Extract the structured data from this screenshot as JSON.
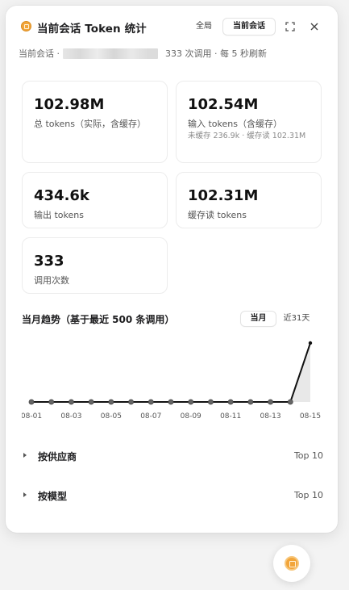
{
  "header": {
    "title": "当前会话 Token 统计",
    "scope_all": "全局",
    "scope_session": "当前会话"
  },
  "subtitle": {
    "prefix": "当前会话 ·",
    "info": "333 次调用 · 每 5 秒刷新"
  },
  "cards": [
    {
      "value": "102.98M",
      "label": "总 tokens（实际，含缓存）"
    },
    {
      "value": "102.54M",
      "label": "输入 tokens（含缓存）",
      "sub": "未缓存 236.9k · 缓存读 102.31M"
    },
    {
      "value": "434.6k",
      "label": "输出 tokens"
    },
    {
      "value": "102.31M",
      "label": "缓存读 tokens"
    },
    {
      "value": "333",
      "label": "调用次数"
    }
  ],
  "trend": {
    "title": "当月趋势（基于最近 500 条调用）",
    "toggle_month": "当月",
    "toggle_31": "近31天"
  },
  "chart_data": {
    "type": "line",
    "x": [
      "08-01",
      "08-02",
      "08-03",
      "08-04",
      "08-05",
      "08-06",
      "08-07",
      "08-08",
      "08-09",
      "08-10",
      "08-11",
      "08-12",
      "08-13",
      "08-14",
      "08-15"
    ],
    "tick_labels": [
      "08-01",
      "08-03",
      "08-05",
      "08-07",
      "08-09",
      "08-11",
      "08-13",
      "08-15"
    ],
    "values": [
      0,
      0,
      0,
      0,
      0,
      0,
      0,
      0,
      0,
      0,
      0,
      0,
      0,
      0,
      102.98
    ],
    "unit": "M tokens",
    "grid": false,
    "area_fill": true,
    "colors": {
      "line": "#111111",
      "area": "#e8e8e8",
      "marker": "#666666"
    }
  },
  "rows": [
    {
      "label": "按供应商",
      "top": "Top 10"
    },
    {
      "label": "按模型",
      "top": "Top 10"
    }
  ],
  "colors": {
    "accent": "#f2a53a",
    "text": "#1d1d1f",
    "muted": "#666666"
  }
}
